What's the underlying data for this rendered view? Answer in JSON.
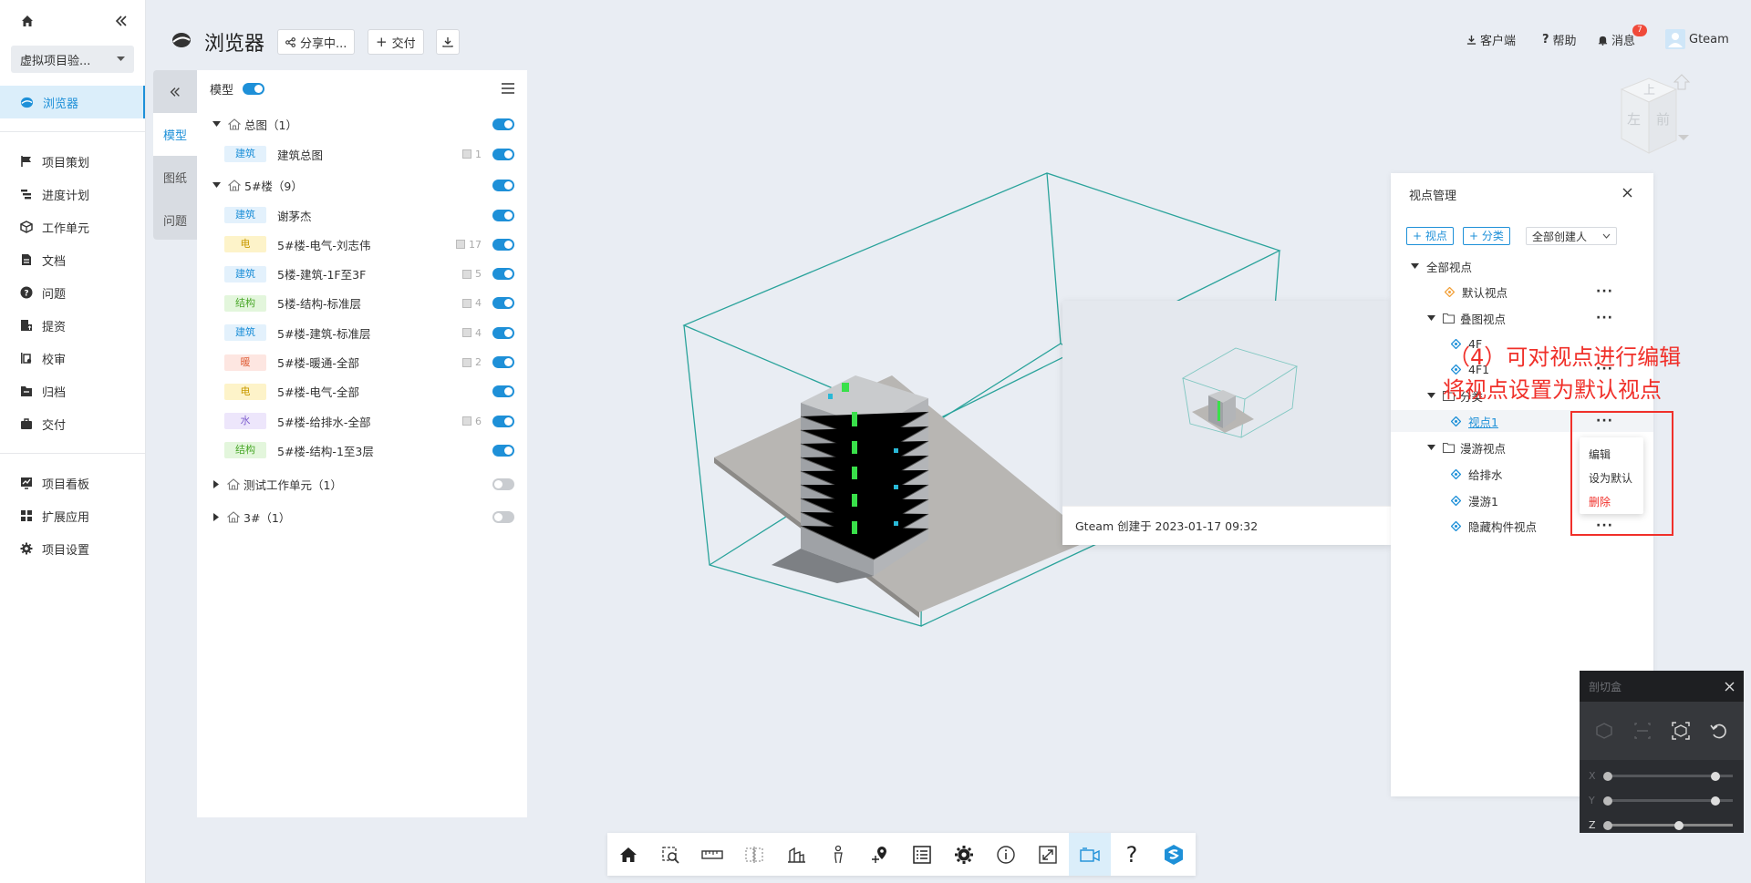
{
  "sidebar": {
    "project": "虚拟项目验...",
    "items": [
      {
        "label": "浏览器",
        "icon": "browser-icon"
      },
      {
        "label": "项目策划",
        "icon": "flag-icon"
      },
      {
        "label": "进度计划",
        "icon": "gantt-icon"
      },
      {
        "label": "工作单元",
        "icon": "cube-icon"
      },
      {
        "label": "文档",
        "icon": "document-icon"
      },
      {
        "label": "问题",
        "icon": "question-icon"
      },
      {
        "label": "提资",
        "icon": "upload-doc-icon"
      },
      {
        "label": "校审",
        "icon": "review-icon"
      },
      {
        "label": "归档",
        "icon": "archive-icon"
      },
      {
        "label": "交付",
        "icon": "briefcase-icon"
      },
      {
        "label": "项目看板",
        "icon": "dashboard-icon"
      },
      {
        "label": "扩展应用",
        "icon": "apps-icon"
      },
      {
        "label": "项目设置",
        "icon": "gear-icon"
      }
    ]
  },
  "header": {
    "title": "浏览器",
    "share": "分享中...",
    "deliver": "交付",
    "client": "客户端",
    "help": "帮助",
    "messages": "消息",
    "badge": "7",
    "user": "Gteam"
  },
  "tabs": [
    "模型",
    "图纸",
    "问题"
  ],
  "model_panel": {
    "header": "模型",
    "groups": [
      {
        "label": "总图（1）",
        "expanded": true,
        "on": true
      },
      {
        "label": "5#楼（9）",
        "expanded": true,
        "on": true
      },
      {
        "label": "测试工作单元（1）",
        "expanded": false,
        "on": false
      },
      {
        "label": "3#（1）",
        "expanded": false,
        "on": false
      }
    ],
    "models": [
      {
        "tag": "建筑",
        "name": "建筑总图",
        "count": "1",
        "on": true
      },
      {
        "tag": "建筑",
        "name": "谢茅杰",
        "count": "",
        "on": true
      },
      {
        "tag": "电",
        "name": "5#楼-电气-刘志伟",
        "count": "17",
        "on": true
      },
      {
        "tag": "建筑",
        "name": "5楼-建筑-1F至3F",
        "count": "5",
        "on": true
      },
      {
        "tag": "结构",
        "name": "5楼-结构-标准层",
        "count": "4",
        "on": true
      },
      {
        "tag": "建筑",
        "name": "5#楼-建筑-标准层",
        "count": "4",
        "on": true
      },
      {
        "tag": "暖",
        "name": "5#楼-暖通-全部",
        "count": "2",
        "on": true
      },
      {
        "tag": "电",
        "name": "5#楼-电气-全部",
        "count": "",
        "on": true
      },
      {
        "tag": "水",
        "name": "5#楼-给排水-全部",
        "count": "6",
        "on": true
      },
      {
        "tag": "结构",
        "name": "5#楼-结构-1至3层",
        "count": "",
        "on": true
      }
    ],
    "tag_colors": {
      "建筑": [
        "#e3f1fc",
        "#1e90d8"
      ],
      "电": [
        "#fdf3c9",
        "#c99a00"
      ],
      "结构": [
        "#e3f6dc",
        "#4aa82a"
      ],
      "暖": [
        "#fde6e1",
        "#e0603a"
      ],
      "水": [
        "#ede6fb",
        "#8060d0"
      ]
    }
  },
  "preview": {
    "caption": "Gteam 创建于 2023-01-17 09:32"
  },
  "view_manager": {
    "title": "视点管理",
    "add_view": "+ 视点",
    "add_category": "+ 分类",
    "creator": "全部创建人",
    "root": "全部视点",
    "default_view": "默认视点",
    "folder_stack": "叠图视点",
    "item_4f": "4F",
    "item_4f1": "4F1",
    "folder_cat": "分类",
    "view1": "视点1",
    "folder_roam": "漫游视点",
    "drain": "给排水",
    "roam1": "漫游1",
    "hidden": "隐藏构件视点",
    "menu": [
      "编辑",
      "设为默认",
      "删除"
    ]
  },
  "annotation": {
    "line1": "（4）可对视点进行编辑",
    "line2": "将视点设置为默认视点",
    "color": "#f0302a"
  },
  "section_box": {
    "title": "剖切盒",
    "axes": [
      "X",
      "Y",
      "Z"
    ]
  },
  "nav_cube": {
    "top": "上",
    "left": "左",
    "front": "前"
  },
  "toolbar": [
    "home-icon",
    "zoom-box-icon",
    "measure-icon",
    "section-icon",
    "structure-icon",
    "person-icon",
    "location-icon",
    "list-icon",
    "gear-icon",
    "info-icon",
    "fullscreen-icon",
    "camera-icon",
    "help-icon",
    "logo-icon"
  ],
  "accent": "#1e90d8"
}
